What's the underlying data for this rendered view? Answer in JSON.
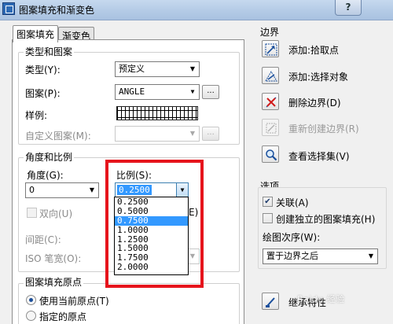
{
  "window": {
    "title": "图案填充和渐变色",
    "help_label": "?"
  },
  "tabs": [
    {
      "label": "图案填充",
      "active": true
    },
    {
      "label": "渐变色",
      "active": false
    }
  ],
  "type_and_pattern": {
    "title": "类型和图案",
    "type_label": "类型(Y):",
    "type_value": "预定义",
    "pattern_label": "图案(P):",
    "pattern_value": "ANGLE",
    "browse_label": "...",
    "swatch_label": "样例:",
    "custom_label": "自定义图案(M):",
    "custom_value": ""
  },
  "angle_and_scale": {
    "title": "角度和比例",
    "angle_label": "角度(G):",
    "angle_value": "0",
    "scale_label": "比例(S):",
    "scale_value": "0.2500",
    "double_label": "双向(U)",
    "relative_tail": "E)",
    "spacing_label": "间距(C):",
    "iso_label": "ISO 笔宽(O):"
  },
  "scale_dropdown": {
    "options": [
      "0.2500",
      "0.5000",
      "0.7500",
      "1.0000",
      "1.2500",
      "1.5000",
      "1.7500",
      "2.0000"
    ],
    "selected_index": 2
  },
  "origin": {
    "title": "图案填充原点",
    "use_current": "使用当前原点(T)",
    "specified": "指定的原点"
  },
  "boundary": {
    "title": "边界",
    "add_pick": "添加:拾取点",
    "add_select": "添加:选择对象",
    "remove": "删除边界(D)",
    "recreate": "重新创建边界(R)",
    "view_selection": "查看选择集(V)"
  },
  "options": {
    "title": "选项",
    "associative": "关联(A)",
    "associative_checked": true,
    "separate": "创建独立的图案填充(H)",
    "separate_checked": false,
    "draw_order_label": "绘图次序(W):",
    "draw_order_value": "置于边界之后",
    "inherit": "继承特性"
  },
  "watermark": "Baidu 经验",
  "colors": {
    "highlight": "#e6141c",
    "selection": "#3399ff"
  }
}
